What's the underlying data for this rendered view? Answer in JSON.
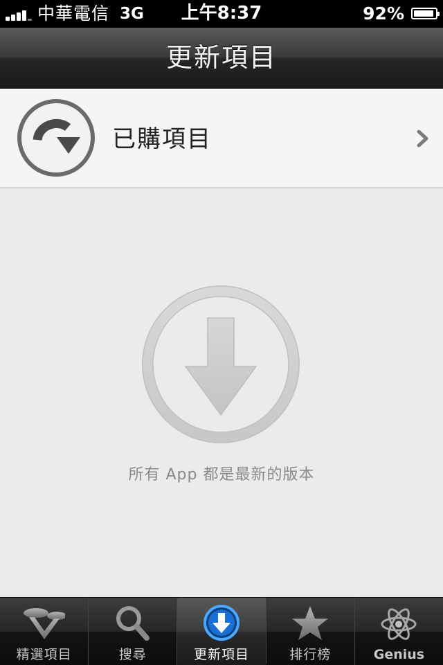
{
  "status_bar": {
    "carrier": "中華電信",
    "network": "3G",
    "time": "上午8:37",
    "battery_percent_label": "92%",
    "battery_level": 0.92,
    "signal_bars": 4
  },
  "nav_bar": {
    "title": "更新項目"
  },
  "purchased_row": {
    "label": "已購項目",
    "icon": "purchased-download-icon",
    "accessory": "chevron-right-icon"
  },
  "empty_state": {
    "icon": "download-arrow-icon",
    "message": "所有 App 都是最新的版本"
  },
  "tab_bar": {
    "selected_index": 2,
    "accent_color": "#2b8cff",
    "tabs": [
      {
        "label": "精選項目",
        "icon": "featured-icon"
      },
      {
        "label": "搜尋",
        "icon": "search-icon"
      },
      {
        "label": "更新項目",
        "icon": "updates-icon"
      },
      {
        "label": "排行榜",
        "icon": "star-icon"
      },
      {
        "label": "Genius",
        "icon": "genius-atom-icon"
      }
    ]
  }
}
